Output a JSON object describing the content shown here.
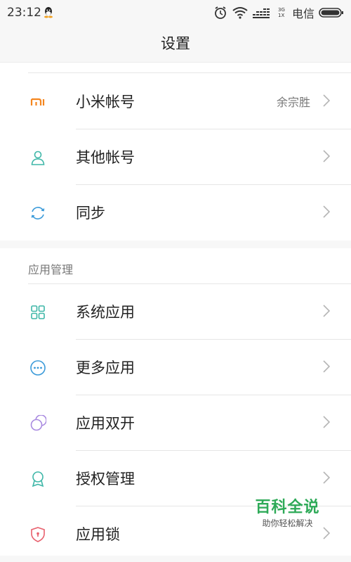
{
  "status_bar": {
    "time": "23:12",
    "network": "3G 1X",
    "carrier": "电信"
  },
  "header": {
    "title": "设置"
  },
  "accounts": [
    {
      "label": "小米帐号",
      "value": "余宗胜",
      "icon": "mi-logo-icon"
    },
    {
      "label": "其他帐号",
      "value": "",
      "icon": "person-icon"
    },
    {
      "label": "同步",
      "value": "",
      "icon": "sync-icon"
    }
  ],
  "app_management": {
    "header": "应用管理",
    "items": [
      {
        "label": "系统应用",
        "icon": "grid-icon"
      },
      {
        "label": "更多应用",
        "icon": "more-dots-icon"
      },
      {
        "label": "应用双开",
        "icon": "dual-apps-icon"
      },
      {
        "label": "授权管理",
        "icon": "award-icon"
      },
      {
        "label": "应用锁",
        "icon": "shield-lock-icon"
      }
    ]
  },
  "watermark": {
    "title": "百科全说",
    "subtitle": "助你轻松解决"
  },
  "colors": {
    "mi_orange": "#f5861f",
    "teal": "#3fb7a8",
    "blue": "#3a9ad9",
    "purple": "#a98ae0",
    "red": "#e8616e",
    "watermark_green": "#2eaa58"
  }
}
